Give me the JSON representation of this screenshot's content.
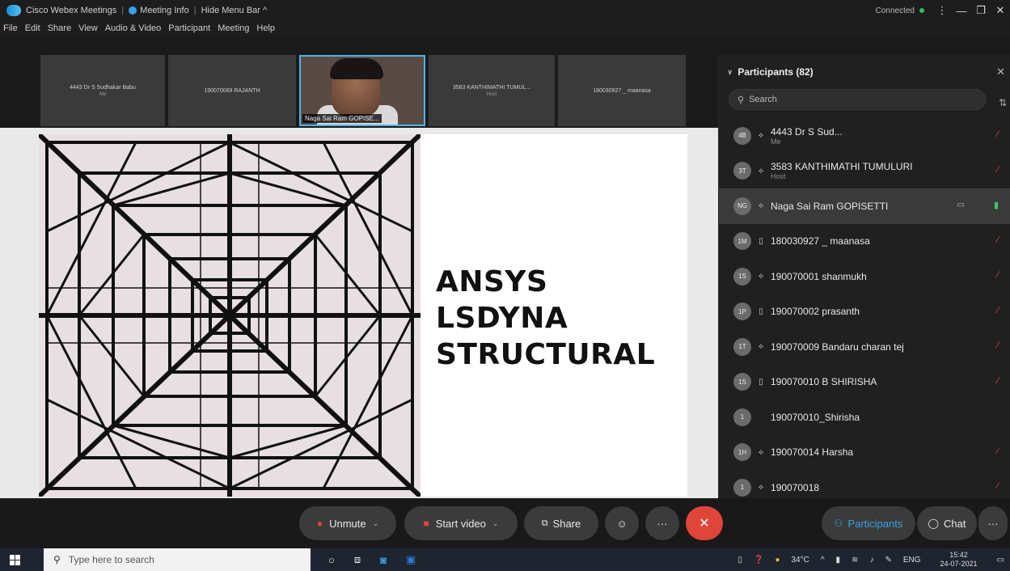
{
  "titlebar": {
    "app_title": "Cisco Webex Meetings",
    "meeting_info": "Meeting Info",
    "hide_menu": "Hide Menu Bar ^",
    "status": "Connected",
    "min": "—",
    "restore": "❐",
    "close": "✕"
  },
  "menu": [
    "File",
    "Edit",
    "Share",
    "View",
    "Audio & Video",
    "Participant",
    "Meeting",
    "Help"
  ],
  "thumbnails": [
    {
      "name": "4443 Dr S Sudhakar Babu",
      "sub": "Me"
    },
    {
      "name": "190070069 RAJANTH",
      "sub": ""
    },
    {
      "name": "Naga Sai Ram GOPISE...",
      "sub": ""
    },
    {
      "name": "3583 KANTHIMATHI TUMUL...",
      "sub": "Host"
    },
    {
      "name": "180030927 _ maanasa",
      "sub": ""
    }
  ],
  "slide": {
    "line1": "ANSYS",
    "line2": "LSDYNA",
    "line3": "STRUCTURAL"
  },
  "panel": {
    "title": "Participants (82)",
    "search_placeholder": "Search",
    "participants": [
      {
        "initials": "4B",
        "device": "⟡",
        "name": "4443 Dr S Sud...",
        "role": "Me",
        "mic": "muted"
      },
      {
        "initials": "3T",
        "device": "⟡",
        "name": "3583 KANTHIMATHI TUMULURI",
        "role": "Host",
        "mic": "muted"
      },
      {
        "initials": "NG",
        "device": "⟡",
        "name": "Naga Sai Ram GOPISETTI",
        "role": "",
        "mic": "on"
      },
      {
        "initials": "1M",
        "device": "▯",
        "name": "180030927 _ maanasa",
        "role": "",
        "mic": "muted"
      },
      {
        "initials": "1S",
        "device": "⟡",
        "name": "190070001 shanmukh",
        "role": "",
        "mic": "muted"
      },
      {
        "initials": "1P",
        "device": "▯",
        "name": "190070002 prasanth",
        "role": "",
        "mic": "muted"
      },
      {
        "initials": "1T",
        "device": "⟡",
        "name": "190070009 Bandaru charan tej",
        "role": "",
        "mic": "muted"
      },
      {
        "initials": "1S",
        "device": "▯",
        "name": "190070010 B SHIRISHA",
        "role": "",
        "mic": "muted"
      },
      {
        "initials": "1",
        "device": "",
        "name": "190070010_Shirisha",
        "role": "",
        "mic": "none"
      },
      {
        "initials": "1H",
        "device": "⟡",
        "name": "190070014 Harsha",
        "role": "",
        "mic": "muted"
      },
      {
        "initials": "1",
        "device": "⟡",
        "name": "190070018",
        "role": "",
        "mic": "muted"
      }
    ]
  },
  "controls": {
    "unmute": "Unmute",
    "start_video": "Start video",
    "share": "Share",
    "reactions": "☺",
    "more": "···",
    "end": "✕",
    "participants": "Participants",
    "chat": "Chat",
    "overflow": "···"
  },
  "taskbar": {
    "search_placeholder": "Type here to search",
    "temperature": "34°C",
    "language": "ENG",
    "time": "15:42",
    "date": "24-07-2021"
  },
  "colors": {
    "accent": "#3aa0e6",
    "end_button": "#e0453a",
    "mic_muted": "#e0453a",
    "mic_on": "#3cc76b"
  }
}
